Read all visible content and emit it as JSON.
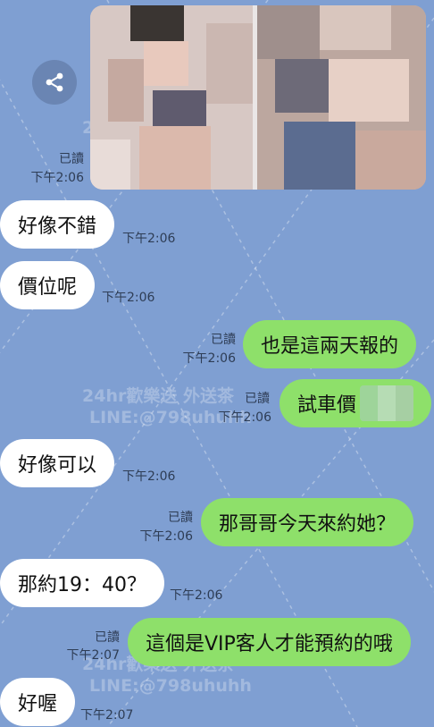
{
  "watermark": {
    "line1": "24hr歡樂送 外送茶",
    "line2": "LINE:@798uhuhh"
  },
  "share": {
    "icon": "share-icon"
  },
  "messages": [
    {
      "side": "sent",
      "read": "已讀",
      "time": "下午2:06",
      "type": "photos"
    },
    {
      "side": "recv",
      "text": "好像不錯",
      "time": "下午2:06"
    },
    {
      "side": "recv",
      "text": "價位呢",
      "time": "下午2:06"
    },
    {
      "side": "sent",
      "text": "也是這兩天報的",
      "read": "已讀",
      "time": "下午2:06"
    },
    {
      "side": "sent",
      "text": "試車價",
      "read": "已讀",
      "time": "下午2:06",
      "redacted": true
    },
    {
      "side": "recv",
      "text": "好像可以",
      "time": "下午2:06"
    },
    {
      "side": "sent",
      "text": "那哥哥今天來約她？",
      "read": "已讀",
      "time": "下午2:06"
    },
    {
      "side": "recv",
      "text": "那約19：40？",
      "time": "下午2:06"
    },
    {
      "side": "sent",
      "text": "這個是VIP客人才能預約的哦",
      "read": "已讀",
      "time": "下午2:07"
    },
    {
      "side": "recv",
      "text": "好喔",
      "time": "下午2:07"
    }
  ]
}
